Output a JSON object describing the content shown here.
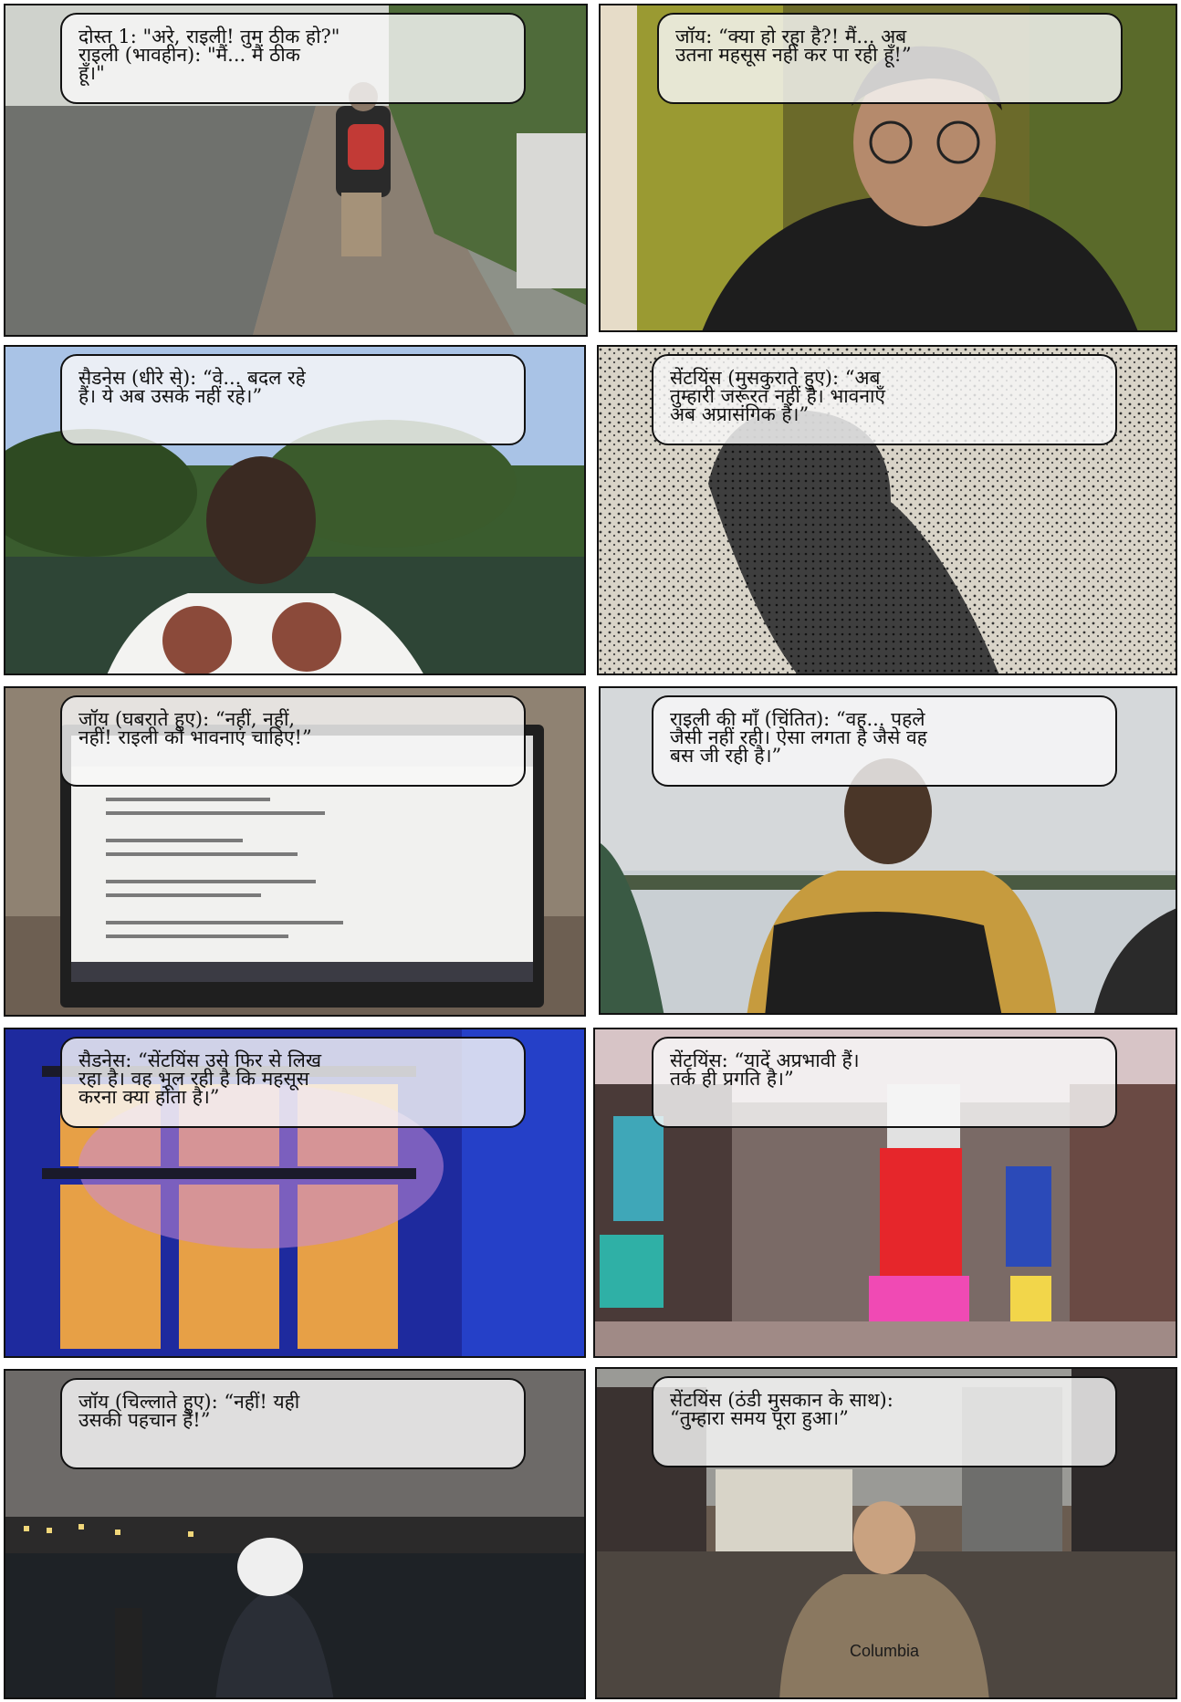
{
  "panels": [
    {
      "caption": "दोस्त 1: \"अरे, राइली! तुम ठीक हो?\"\nराइली (भावहीन): \"मैं... मैं ठीक\nहूँ।\""
    },
    {
      "caption": "जॉय: “क्या हो रहा है?!  मैं... अब\nउतना महसूस नहीं कर पा रही हूँ!”"
    },
    {
      "caption": "सैडनेस (धीरे से): “वे... बदल रहे\nहैं।  ये अब उसके नहीं रहे।”"
    },
    {
      "caption": "सेंटयिंस (मुसकुराते हुए): “अब\nतुम्हारी जरूरत नहीं है।  भावनाएँ\nअब अप्रासंगिक हैं।”"
    },
    {
      "caption": "जॉय (घबराते हुए): “नहीं, नहीं,\nनहीं!  राइली को भावनाएं चाहिए!”"
    },
    {
      "caption": "राइली की माँ (चिंतित): “वह... पहले\nजैसी नहीं रही।  ऐसा लगता है जैसे वह\nबस जी रही है।”"
    },
    {
      "caption": "सैडनेस: “सेंटयिंस उसे फिर से लिख\nरहा है।  वह भूल रही है कि महसूस\nकरना क्या होता है।”"
    },
    {
      "caption": "सेंटयिंस: “यादें अप्रभावी हैं।\nतर्क ही प्रगति है।”"
    },
    {
      "caption": "जॉय (चिल्लाते हुए): “नहीं!  यही\nउसकी पहचान है!”"
    },
    {
      "caption": "सेंटयिंस (ठंडी मुसकान के साथ):\n“तुम्हारा समय पूरा हुआ।”"
    }
  ],
  "scene_text": {
    "hoodie_brand": "Columbia"
  }
}
